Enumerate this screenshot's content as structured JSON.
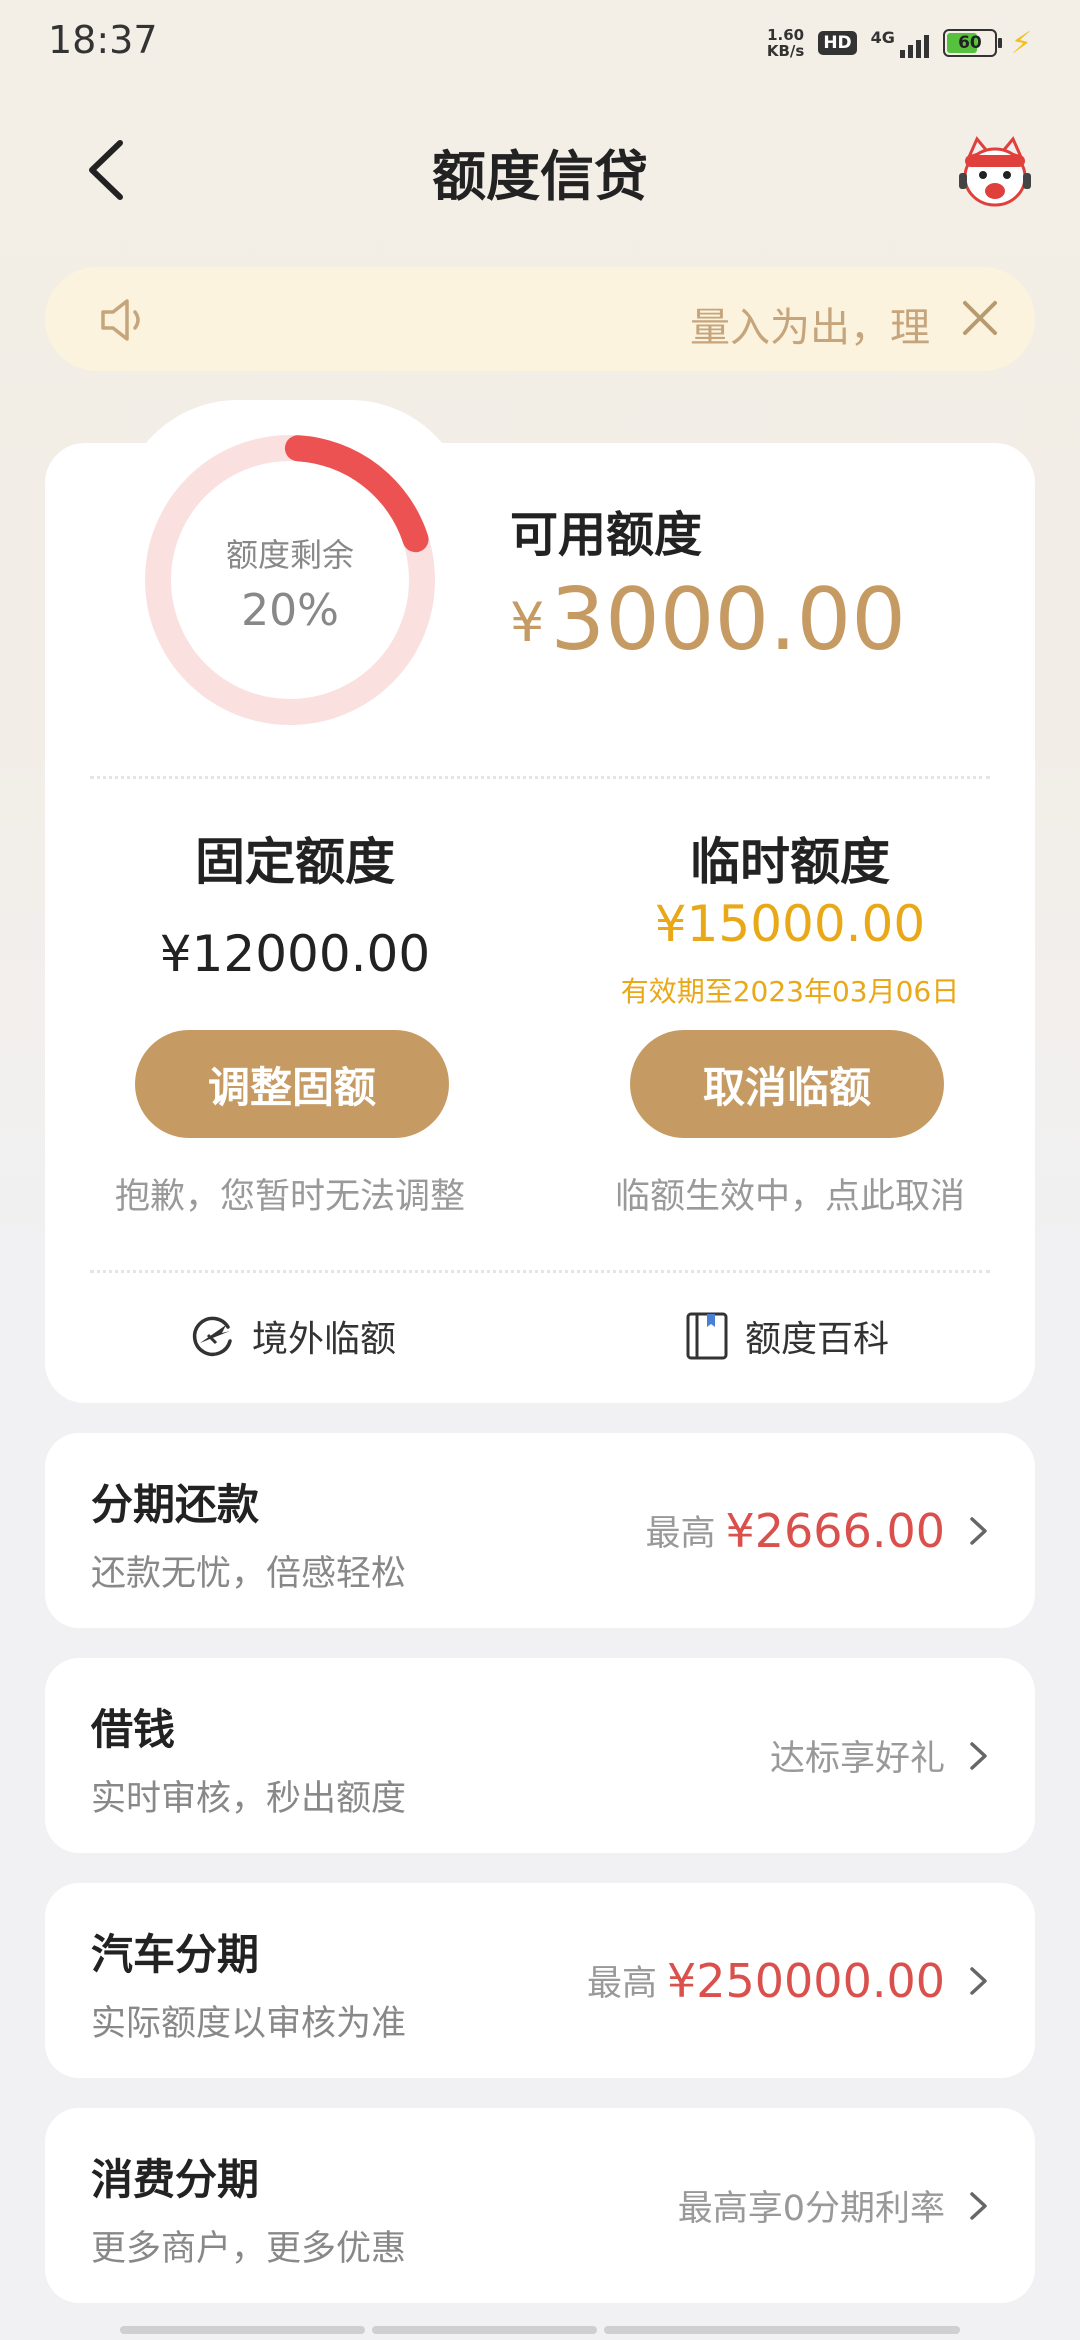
{
  "status_bar": {
    "time": "18:37",
    "net_speed_value": "1.60",
    "net_speed_unit": "KB/s",
    "hd": "HD",
    "network": "4G",
    "battery": "60"
  },
  "header": {
    "title": "额度信贷"
  },
  "notice": {
    "text": "量入为出，理"
  },
  "credit": {
    "ring_label": "额度剩余",
    "ring_percent": "20%",
    "remaining_fraction": 0.2,
    "available_label": "可用额度",
    "currency": "¥",
    "available_amount": "3000.00",
    "fixed_title": "固定额度",
    "fixed_amount": "¥12000.00",
    "temp_title": "临时额度",
    "temp_amount": "¥15000.00",
    "temp_expiry": "有效期至2023年03月06日",
    "adjust_button": "调整固额",
    "adjust_hint": "抱歉，您暂时无法调整",
    "cancel_button": "取消临额",
    "cancel_hint": "临额生效中，点此取消",
    "overseas_link": "境外临额",
    "wiki_link": "额度百科"
  },
  "list": [
    {
      "title": "分期还款",
      "subtitle": "还款无忧，倍感轻松",
      "right_prefix": "最高",
      "right_amount": "¥2666.00"
    },
    {
      "title": "借钱",
      "subtitle": "实时审核，秒出额度",
      "right_text": "达标享好礼"
    },
    {
      "title": "汽车分期",
      "subtitle": "实际额度以审核为准",
      "right_prefix": "最高",
      "right_amount": "¥250000.00"
    },
    {
      "title": "消费分期",
      "subtitle": "更多商户，更多优惠",
      "right_text": "最高享0分期利率"
    }
  ],
  "colors": {
    "accent_gold": "#c69b63",
    "temp_yellow": "#e8a818",
    "ring_red": "#ec5251",
    "amount_red": "#d9504c"
  },
  "icons": [
    "back-arrow-icon",
    "mascot-icon",
    "speaker-icon",
    "close-icon",
    "airplane-globe-icon",
    "book-icon",
    "chevron-right-icon"
  ]
}
